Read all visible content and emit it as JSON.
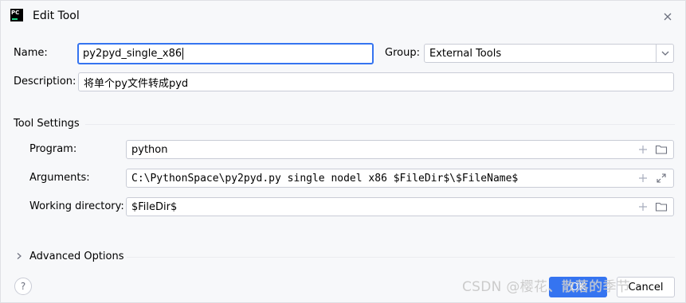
{
  "window": {
    "title": "Edit Tool",
    "app_icon_text": "PC"
  },
  "form": {
    "name_label": "Name:",
    "name_value": "py2pyd_single_x86",
    "group_label": "Group:",
    "group_value": "External Tools",
    "description_label": "Description:",
    "description_value": "将单个py文件转成pyd"
  },
  "tool_settings": {
    "section_title": "Tool Settings",
    "program_label": "Program:",
    "program_value": "python",
    "arguments_label": "Arguments:",
    "arguments_value": "C:\\PythonSpace\\py2pyd.py single nodel x86 $FileDir$\\$FileName$",
    "working_dir_label": "Working directory:",
    "working_dir_value": "$FileDir$"
  },
  "advanced": {
    "label": "Advanced Options"
  },
  "footer": {
    "help_label": "?",
    "ok_label": "OK",
    "cancel_label": "Cancel"
  },
  "watermark": "CSDN @樱花、散落的季节",
  "colors": {
    "background": "#f7f8fa",
    "accent": "#3574f0",
    "border": "#c9ccd6"
  },
  "icons": [
    "close-icon",
    "chevron-down-icon",
    "plus-icon",
    "folder-icon",
    "expand-icon",
    "chevron-right-icon",
    "help-icon"
  ]
}
